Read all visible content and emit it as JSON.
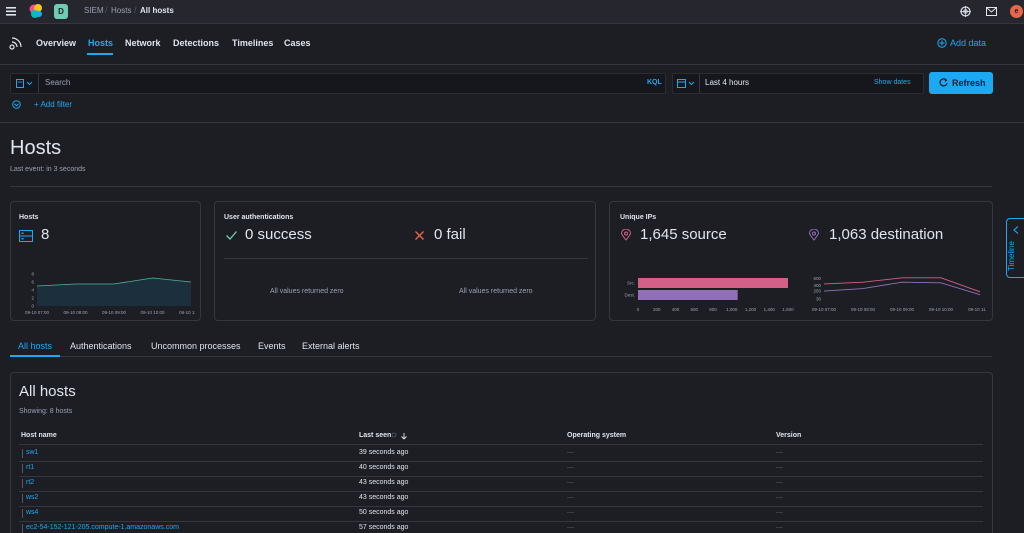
{
  "breadcrumbs": [
    "SIEM",
    "Hosts",
    "All hosts"
  ],
  "space_letter": "D",
  "avatar_letter": "e",
  "nav": {
    "tabs": [
      "Overview",
      "Hosts",
      "Network",
      "Detections",
      "Timelines",
      "Cases"
    ],
    "active": "Hosts",
    "add_data": "Add data"
  },
  "query": {
    "search_placeholder": "Search",
    "kql": "KQL",
    "date_range": "Last 4 hours",
    "show_dates": "Show dates",
    "refresh": "Refresh",
    "add_filter": "+ Add filter"
  },
  "page": {
    "title": "Hosts",
    "last_event": "Last event: in 3 seconds"
  },
  "kpis": {
    "hosts": {
      "title": "Hosts",
      "value": "8",
      "chart_x_labels": [
        "09-10 07:00",
        "09-10 08:00",
        "09-10 09:00",
        "09-10 10:00",
        "09-10 11:00"
      ],
      "chart_y_labels": [
        "8",
        "6",
        "4",
        "2",
        "0"
      ]
    },
    "auth": {
      "title": "User authentications",
      "success": "0 success",
      "fail": "0 fail",
      "zero_msg_left": "All values returned zero",
      "zero_msg_right": "All values returned zero"
    },
    "ips": {
      "title": "Unique IPs",
      "source": "1,645 source",
      "destination": "1,063 destination",
      "bar_labels": [
        "Src.",
        "Dest."
      ],
      "bar_x_labels": [
        "0",
        "200",
        "400",
        "600",
        "800",
        "1,000",
        "1,200",
        "1,400",
        "1,600"
      ],
      "line_y_labels": [
        "600",
        "400",
        "250",
        "30"
      ],
      "line_x_labels": [
        "09-10 07:00",
        "09-10 08:00",
        "09-10 09:00",
        "09-10 10:00",
        "09-10 11:00"
      ],
      "colors": {
        "source": "#d36086",
        "destination": "#9170b8"
      }
    }
  },
  "timeline_tab": "Timeline",
  "subtabs": [
    "All hosts",
    "Authentications",
    "Uncommon processes",
    "Events",
    "External alerts"
  ],
  "table": {
    "title": "All hosts",
    "showing": "Showing: 8 hosts",
    "columns": [
      "Host name",
      "Last seen",
      "Operating system",
      "Version"
    ],
    "rows": [
      {
        "host": "sw1",
        "last_seen": "39 seconds ago",
        "os": "—",
        "version": "—"
      },
      {
        "host": "rt1",
        "last_seen": "40 seconds ago",
        "os": "—",
        "version": "—"
      },
      {
        "host": "rt2",
        "last_seen": "43 seconds ago",
        "os": "—",
        "version": "—"
      },
      {
        "host": "ws2",
        "last_seen": "43 seconds ago",
        "os": "—",
        "version": "—"
      },
      {
        "host": "ws4",
        "last_seen": "50 seconds ago",
        "os": "—",
        "version": "—"
      },
      {
        "host": "ec2-54-152-121-205.compute-1.amazonaws.com",
        "last_seen": "57 seconds ago",
        "os": "—",
        "version": "—"
      }
    ]
  },
  "chart_data": [
    {
      "type": "area",
      "x": [
        "09-10 07:00",
        "09-10 08:00",
        "09-10 09:00",
        "09-10 10:00",
        "09-10 11:00"
      ],
      "series": [
        {
          "values": [
            5,
            5.5,
            5.5,
            7,
            6
          ]
        }
      ],
      "ylim": [
        0,
        8
      ]
    },
    {
      "type": "bar",
      "categories": [
        "Src.",
        "Dest."
      ],
      "values": [
        1645,
        1063
      ],
      "xlim": [
        0,
        1600
      ]
    },
    {
      "type": "line",
      "x": [
        "09-10 07:00",
        "09-10 08:00",
        "09-10 09:00",
        "09-10 10:00",
        "09-10 11:00"
      ],
      "series": [
        {
          "values": [
            450,
            500,
            620,
            620,
            230
          ]
        },
        {
          "values": [
            250,
            320,
            500,
            480,
            150
          ]
        }
      ],
      "ylim": [
        0,
        700
      ]
    }
  ]
}
